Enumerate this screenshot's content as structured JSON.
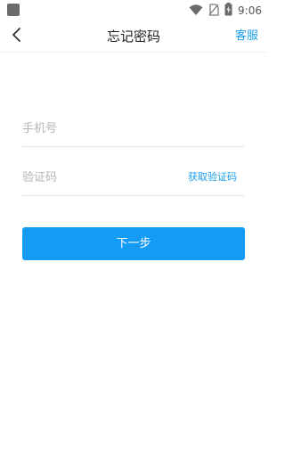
{
  "status_bar": {
    "time": "9:06",
    "icons": [
      "app-notification-icon",
      "wifi-icon",
      "no-sim-icon",
      "battery-charging-icon"
    ]
  },
  "header": {
    "title": "忘记密码",
    "right_action": "客服",
    "back_icon": "chevron-left-icon"
  },
  "form": {
    "phone_placeholder": "手机号",
    "phone_value": "",
    "code_placeholder": "验证码",
    "code_value": "",
    "get_code_label": "获取验证码"
  },
  "actions": {
    "next_label": "下一步"
  },
  "colors": {
    "accent": "#149cf5",
    "link": "#1aa0f0",
    "divider": "#e4e4e4",
    "placeholder": "#b5b5b5"
  }
}
